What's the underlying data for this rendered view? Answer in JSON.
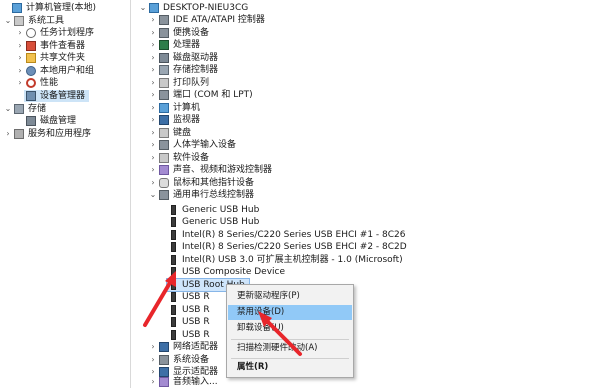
{
  "left_tree": {
    "items": [
      {
        "label": "计算机管理(本地)",
        "icon": "computer-icon",
        "twist": ""
      },
      {
        "label": "系统工具",
        "icon": "tools-icon",
        "twist": "v"
      },
      {
        "label": "任务计划程序",
        "icon": "clock-icon",
        "twist": ">"
      },
      {
        "label": "事件查看器",
        "icon": "event-viewer-icon",
        "twist": ">"
      },
      {
        "label": "共享文件夹",
        "icon": "folder-icon",
        "twist": ">"
      },
      {
        "label": "本地用户和组",
        "icon": "users-icon",
        "twist": ">"
      },
      {
        "label": "性能",
        "icon": "performance-icon",
        "twist": ">"
      },
      {
        "label": "设备管理器",
        "icon": "device-manager-icon",
        "twist": ""
      },
      {
        "label": "存储",
        "icon": "storage-icon",
        "twist": "v"
      },
      {
        "label": "磁盘管理",
        "icon": "disk-icon",
        "twist": ""
      },
      {
        "label": "服务和应用程序",
        "icon": "services-icon",
        "twist": ">"
      }
    ]
  },
  "right_tree": {
    "root": "DESKTOP-NIEU3CG",
    "categories": [
      "IDE ATA/ATAPI 控制器",
      "便携设备",
      "处理器",
      "磁盘驱动器",
      "存储控制器",
      "打印队列",
      "端口 (COM 和 LPT)",
      "计算机",
      "监视器",
      "键盘",
      "人体学输入设备",
      "软件设备",
      "声音、视频和游戏控制器",
      "鼠标和其他指针设备",
      "通用串行总线控制器"
    ],
    "usb_children": [
      "Generic USB Hub",
      "Generic USB Hub",
      "Intel(R) 8 Series/C220 Series USB EHCI #1 - 8C26",
      "Intel(R) 8 Series/C220 Series USB EHCI #2 - 8C2D",
      "Intel(R) USB 3.0 可扩展主机控制器 - 1.0 (Microsoft)",
      "USB Composite Device",
      "USB Root Hub",
      "USB R",
      "USB R",
      "USB R",
      "USB R"
    ],
    "after": [
      "网络适配器",
      "系统设备",
      "显示适配器",
      "音频输入..."
    ]
  },
  "context_menu": {
    "items": [
      "更新驱动程序(P)",
      "禁用设备(D)",
      "卸载设备(U)",
      "扫描检测硬件改动(A)",
      "属性(R)"
    ]
  },
  "colors": {
    "highlight": "#91c9f7",
    "arrow": "#e8262b",
    "selection": "#cfe5fb"
  }
}
